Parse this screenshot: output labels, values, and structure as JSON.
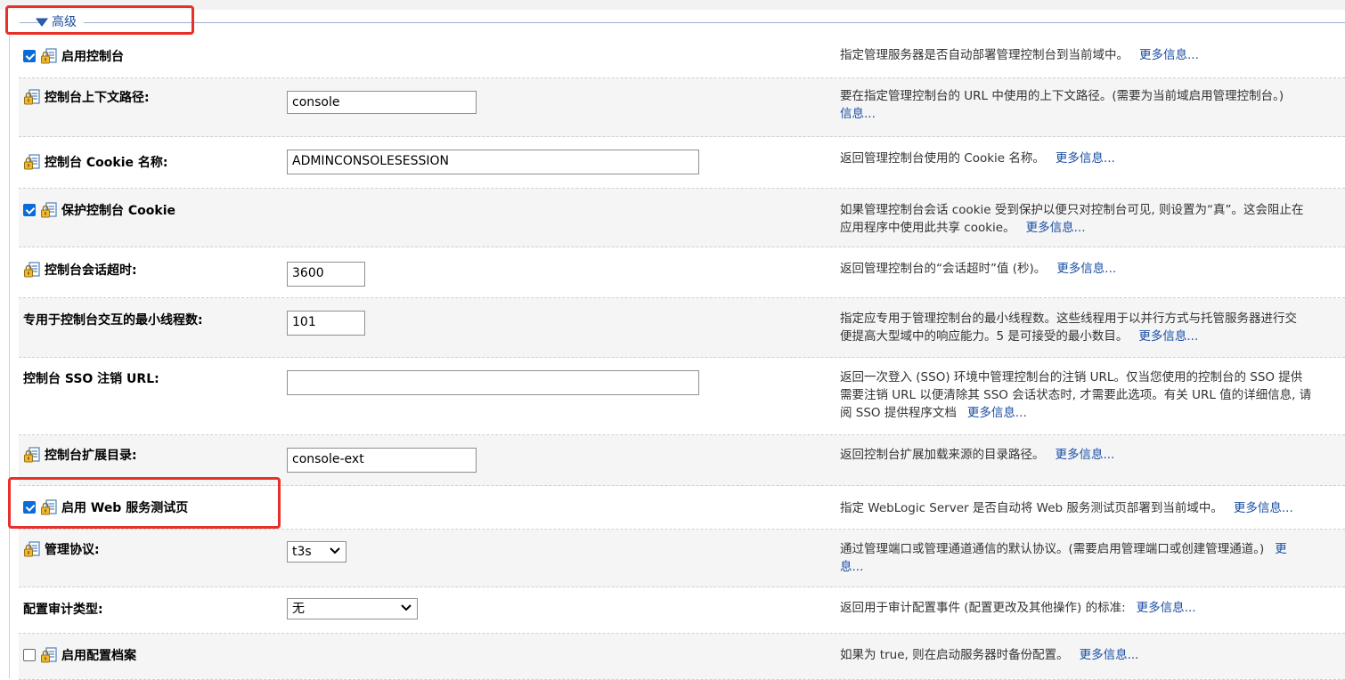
{
  "section": {
    "title": "高级",
    "collapse_icon": "triangle-down-icon"
  },
  "rows": {
    "enable_console": {
      "label": "启用控制台",
      "checked": true,
      "description": "指定管理服务器是否自动部署管理控制台到当前域中。",
      "more": "更多信息..."
    },
    "context_path": {
      "label": "控制台上下文路径:",
      "value": "console",
      "description_line1": "要在指定管理控制台的 URL 中使用的上下文路径。(需要为当前域启用管理控制台。)",
      "description_line2": "信息..."
    },
    "cookie_name": {
      "label": "控制台 Cookie 名称:",
      "value": "ADMINCONSOLESESSION",
      "description": "返回管理控制台使用的 Cookie 名称。",
      "more": "更多信息..."
    },
    "protect_cookie": {
      "label": "保护控制台 Cookie",
      "checked": true,
      "description_line1": "如果管理控制台会话 cookie 受到保护以便只对控制台可见, 则设置为“真”。这会阻止在",
      "description_line2": "应用程序中使用此共享 cookie。",
      "more": "更多信息..."
    },
    "session_timeout": {
      "label": "控制台会话超时:",
      "value": "3600",
      "description": "返回管理控制台的“会话超时”值 (秒)。",
      "more": "更多信息..."
    },
    "min_threads": {
      "label": "专用于控制台交互的最小线程数:",
      "value": "101",
      "description_line1": "指定应专用于管理控制台的最小线程数。这些线程用于以并行方式与托管服务器进行交",
      "description_line2": "便提高大型域中的响应能力。5 是可接受的最小数目。",
      "more": "更多信息..."
    },
    "sso_logout_url": {
      "label": "控制台 SSO 注销 URL:",
      "value": "",
      "description_line1": "返回一次登入 (SSO) 环境中管理控制台的注销 URL。仅当您使用的控制台的 SSO 提供",
      "description_line2": "需要注销 URL 以便清除其 SSO 会话状态时, 才需要此选项。有关 URL 值的详细信息, 请",
      "description_line3": "阅 SSO 提供程序文档",
      "more": "更多信息..."
    },
    "extension_dir": {
      "label": "控制台扩展目录:",
      "value": "console-ext",
      "description": "返回控制台扩展加载来源的目录路径。",
      "more": "更多信息..."
    },
    "web_service_test_page": {
      "label": "启用 Web 服务测试页",
      "checked": true,
      "description": "指定 WebLogic Server 是否自动将 Web 服务测试页部署到当前域中。",
      "more": "更多信息..."
    },
    "admin_protocol": {
      "label": "管理协议:",
      "selected": "t3s",
      "description_line1": "通过管理端口或管理通道通信的默认协议。(需要启用管理端口或创建管理通道。)",
      "more_cut": "更",
      "description_line2": "息..."
    },
    "config_audit": {
      "label": "配置审计类型:",
      "selected": "无",
      "description": "返回用于审计配置事件 (配置更改及其他操作) 的标准:",
      "more": "更多信息..."
    },
    "config_archive": {
      "label": "启用配置档案",
      "checked": false,
      "description": "如果为 true, 则在启动服务器时备份配置。",
      "more": "更多信息..."
    }
  },
  "icons": {
    "lock": "lock-config-icon",
    "chevron": "chevron-down-icon"
  },
  "colors": {
    "link": "#1a4ea3",
    "highlight": "#e8302b",
    "checkbox": "#0b6bd9",
    "section_title": "#1f4e9c"
  }
}
